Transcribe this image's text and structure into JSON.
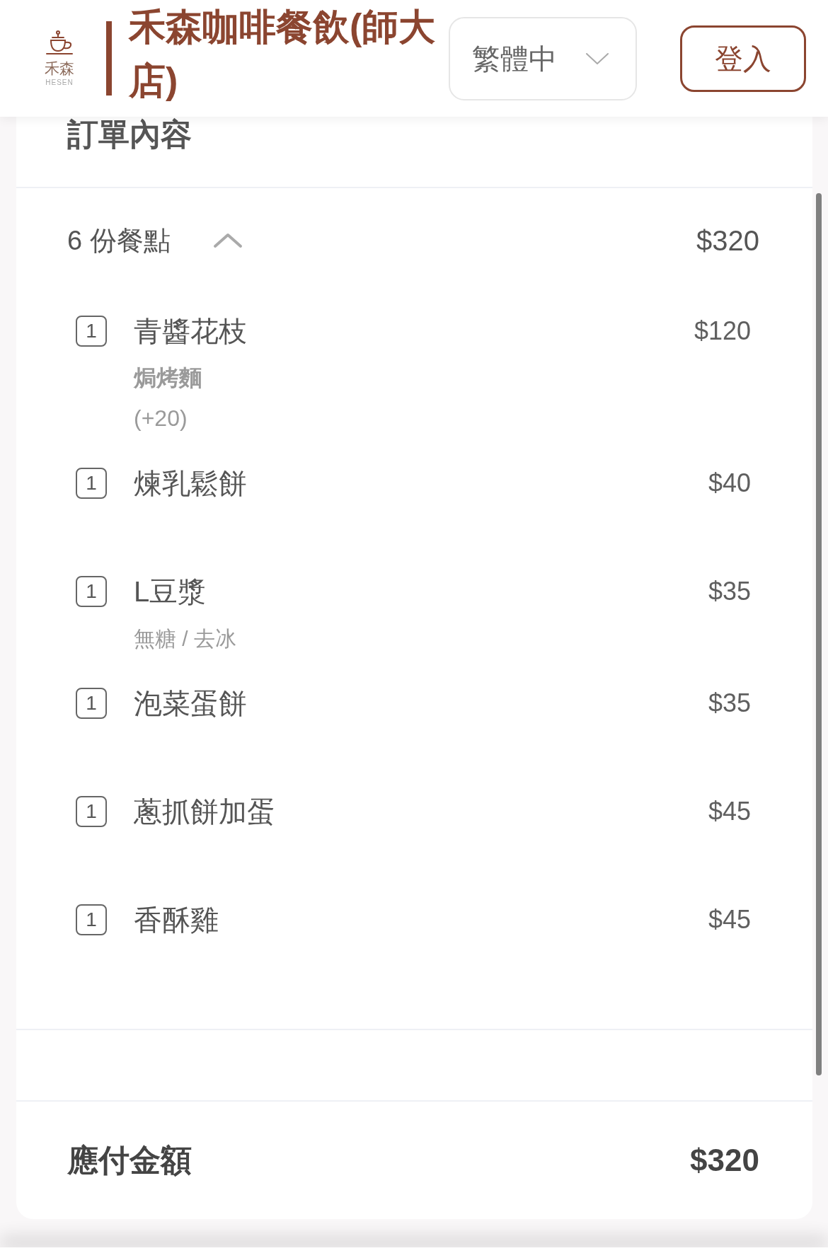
{
  "header": {
    "logo": {
      "name": "禾森",
      "subtitle": "HESEN"
    },
    "store_name": "禾森咖啡餐飲(師大店)",
    "language_select": {
      "value": "繁體中"
    },
    "login_button": "登入"
  },
  "order": {
    "title": "訂單內容",
    "count_label": "6 份餐點",
    "expanded": true,
    "subtotal": "$320",
    "items": [
      {
        "qty": "1",
        "name": "青醬花枝",
        "price": "$120",
        "options": [
          {
            "kind": "choice",
            "text": "焗烤麵"
          },
          {
            "kind": "surcharge",
            "text": "(+20)"
          }
        ]
      },
      {
        "qty": "1",
        "name": "煉乳鬆餅",
        "price": "$40"
      },
      {
        "qty": "1",
        "name": "L豆漿",
        "price": "$35",
        "options": [
          {
            "kind": "note",
            "text": "無糖 / 去冰"
          }
        ]
      },
      {
        "qty": "1",
        "name": "泡菜蛋餅",
        "price": "$35"
      },
      {
        "qty": "1",
        "name": "蔥抓餅加蛋",
        "price": "$45"
      },
      {
        "qty": "1",
        "name": "香酥雞",
        "price": "$45"
      }
    ]
  },
  "total": {
    "label": "應付金額",
    "amount": "$320"
  }
}
